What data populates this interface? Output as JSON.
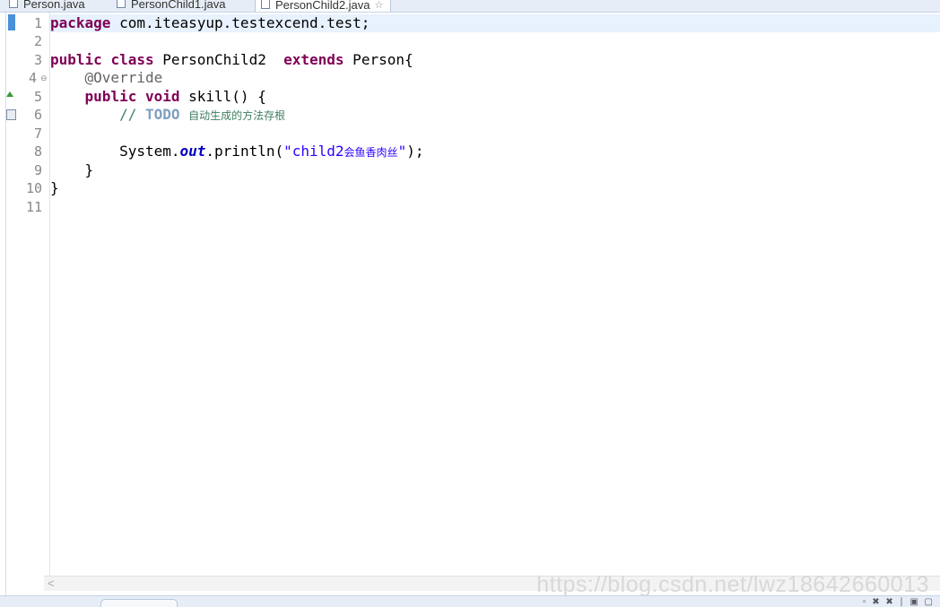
{
  "tabs": [
    {
      "label": "Person.java",
      "active": false
    },
    {
      "label": "PersonChild1.java",
      "active": false
    },
    {
      "label": "PersonChild2.java",
      "active": true,
      "close": "☆"
    }
  ],
  "code": {
    "line_numbers": [
      "1",
      "2",
      "3",
      "4",
      "5",
      "6",
      "7",
      "8",
      "9",
      "10",
      "11"
    ],
    "l1": {
      "kw": "package",
      "rest": " com.iteasyup.testexcend.test;"
    },
    "l3": {
      "kw1": "public",
      "kw2": "class",
      "name": " PersonChild2  ",
      "kw3": "extends",
      "rest": " Person{"
    },
    "l4": {
      "ann": "@Override"
    },
    "l5": {
      "kw1": "public",
      "kw2": "void",
      "rest": " skill() {"
    },
    "l6": {
      "slashes": "// ",
      "todo": "TODO",
      "text": "自动生成的方法存根"
    },
    "l8": {
      "pre": "System.",
      "field": "out",
      "mid": ".println(",
      "str1": "\"child2",
      "cjk": "会鱼香肉丝",
      "str2": "\"",
      "post": ");"
    },
    "l9": "}",
    "l10": "}"
  },
  "scroll_left": "<",
  "watermark": "https://blog.csdn.net/lwz18642660013",
  "colors": {
    "keyword": "#7f0055",
    "comment": "#3f7f5f",
    "string": "#2a00ff",
    "field": "#0000c0",
    "annotation": "#646464",
    "current_line": "#e8f2fe"
  }
}
